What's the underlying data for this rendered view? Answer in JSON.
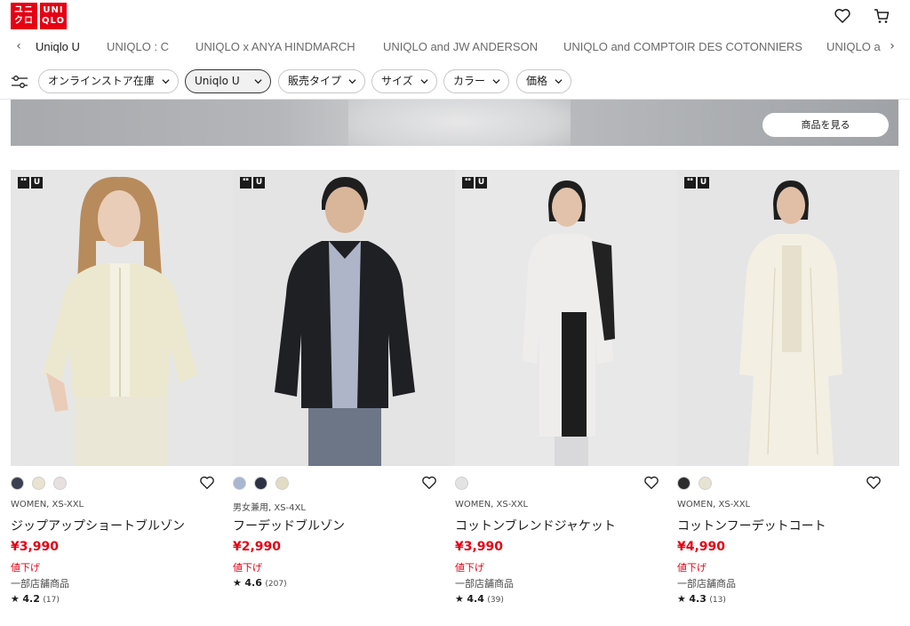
{
  "header": {
    "logo_top": [
      "ユニ",
      "クロ"
    ],
    "logo_bottom": [
      "UNI",
      "QLO"
    ],
    "icons": [
      "heart-icon",
      "cart-icon"
    ]
  },
  "tabs": [
    {
      "label": "Uniqlo U",
      "active": true
    },
    {
      "label": "UNIQLO : C",
      "active": false
    },
    {
      "label": "UNIQLO x ANYA HINDMARCH",
      "active": false
    },
    {
      "label": "UNIQLO and JW ANDERSON",
      "active": false
    },
    {
      "label": "UNIQLO and COMPTOIR DES COTONNIERS",
      "active": false
    },
    {
      "label": "UNIQLO a",
      "active": false
    }
  ],
  "filters": [
    {
      "label": "オンラインストア在庫",
      "selected": false
    },
    {
      "label": "Uniqlo U",
      "selected": true
    },
    {
      "label": "販売タイプ",
      "selected": false
    },
    {
      "label": "サイズ",
      "selected": false
    },
    {
      "label": "カラー",
      "selected": false
    },
    {
      "label": "価格",
      "selected": false
    }
  ],
  "banner": {
    "button_label": "商品を見る"
  },
  "badge": {
    "u_label": "U"
  },
  "products": [
    {
      "colors": [
        "#3b4150",
        "#e8e4cf",
        "#e7dfe0"
      ],
      "meta": "WOMEN, XS-XXL",
      "name": "ジップアップショートブルゾン",
      "price": "¥3,990",
      "flag": "値下げ",
      "store": "一部店舗商品",
      "rating": "4.2",
      "reviews": "(17)"
    },
    {
      "colors": [
        "#a9b6cf",
        "#2e3344",
        "#e2dcc5"
      ],
      "meta": "男女兼用, XS-4XL",
      "name": "フーデッドブルゾン",
      "price": "¥2,990",
      "flag": "値下げ",
      "store": "",
      "rating": "4.6",
      "reviews": "(207)"
    },
    {
      "colors": [
        "#e3e3e3"
      ],
      "meta": "WOMEN, XS-XXL",
      "name": "コットンブレンドジャケット",
      "price": "¥3,990",
      "flag": "値下げ",
      "store": "一部店舗商品",
      "rating": "4.4",
      "reviews": "(39)"
    },
    {
      "colors": [
        "#2c2c2c",
        "#e7e2d2"
      ],
      "meta": "WOMEN, XS-XXL",
      "name": "コットンフーデットコート",
      "price": "¥4,990",
      "flag": "値下げ",
      "store": "一部店舗商品",
      "rating": "4.3",
      "reviews": "(13)"
    }
  ]
}
